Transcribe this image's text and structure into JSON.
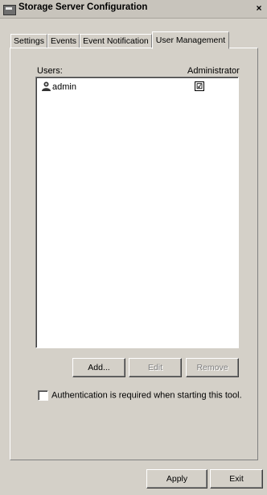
{
  "window": {
    "title": "Storage Server Configuration",
    "close_label": "×"
  },
  "tabs": [
    {
      "label": "Settings",
      "active": false
    },
    {
      "label": "Events",
      "active": false
    },
    {
      "label": "Event Notification",
      "active": false
    },
    {
      "label": "User Management",
      "active": true
    }
  ],
  "users_panel": {
    "users_label": "Users:",
    "admin_label": "Administrator",
    "users": [
      {
        "name": "admin",
        "administrator": true,
        "check": "☑"
      }
    ]
  },
  "buttons": {
    "add": "Add...",
    "edit": "Edit",
    "remove": "Remove"
  },
  "auth": {
    "label": "Authentication is required when starting this tool.",
    "checked": false
  },
  "footer": {
    "apply": "Apply",
    "exit": "Exit"
  }
}
